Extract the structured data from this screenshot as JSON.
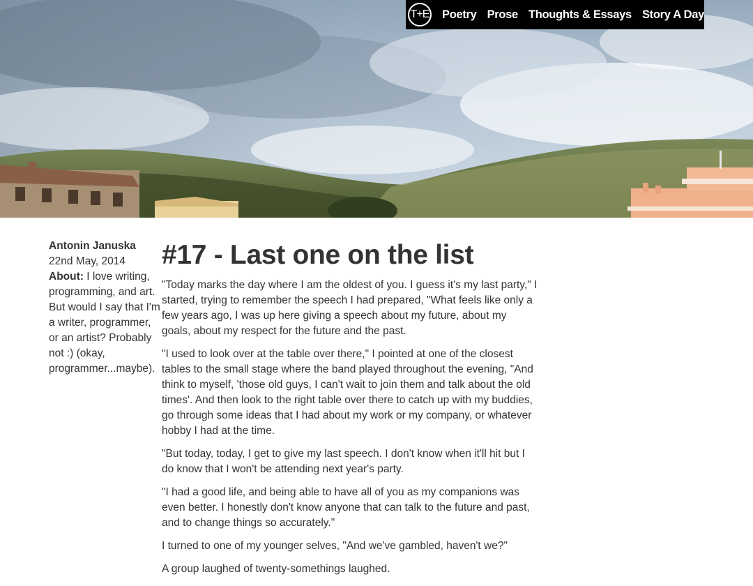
{
  "nav": {
    "logo_text": "T+E",
    "links": [
      "Poetry",
      "Prose",
      "Thoughts & Essays",
      "Story A Day"
    ]
  },
  "sidebar": {
    "author": "Antonin Januska",
    "date": "22nd May, 2014",
    "about_label": "About:",
    "about_text": " I love writing, programming, and art. But would I say that I'm a writer, programmer, or an artist? Probably not :) (okay, programmer...maybe)."
  },
  "article": {
    "title": "#17 - Last one on the list",
    "paragraphs": [
      "\"Today marks the day where I am the oldest of you. I guess it's my last party,\" I started, trying to remember the speech I had prepared, \"What feels like only a few years ago, I was up here giving a speech about my future, about my goals, about my respect for the future and the past.",
      "\"I used to look over at the table over there,\" I pointed at one of the closest tables to the small stage where the band played throughout the evening, \"And think to myself, 'those old guys, I can't wait to join them and talk about the old times'. And then look to the right table over there to catch up with my buddies, go through some ideas that I had about my work or my company, or whatever hobby I had at the time.",
      "\"But today, today, I get to give my last speech. I don't know when it'll hit but I do know that I won't be attending next year's party.",
      "\"I had a good life, and being able to have all of you as my companions was even better. I honestly don't know anyone that can talk to the future and past, and to change things so accurately.\"",
      "I turned to one of my younger selves, \"And we've gambled, haven't we?\"",
      "A group laughed of twenty-somethings laughed."
    ]
  },
  "colors": {
    "nav_bg": "#000000",
    "text": "#333333",
    "sky": "#b9c6d2"
  }
}
